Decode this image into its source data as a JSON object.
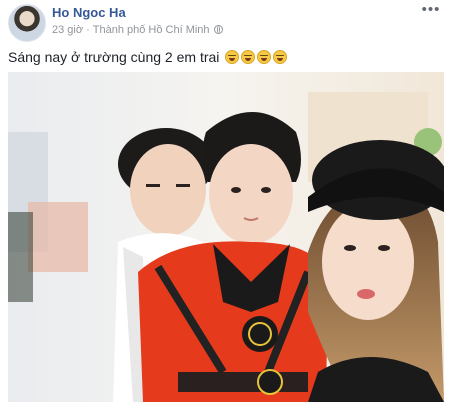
{
  "post": {
    "author": "Ho Ngoc Ha",
    "time": "23 giờ",
    "separator": "·",
    "location": "Thành phố Hồ Chí Minh",
    "more_label": "•••",
    "caption": "Sáng nay ở trường cùng 2 em trai",
    "caption_emoji": [
      "laughing-tears-emoji",
      "laughing-tears-emoji",
      "laughing-tears-emoji",
      "laughing-tears-emoji"
    ]
  },
  "icons": {
    "privacy": "globe-icon",
    "more": "more-dots-icon"
  },
  "colors": {
    "author": "#365899",
    "meta": "#90949c",
    "text": "#1d2129",
    "costume_red": "#e63a1c",
    "hat": "#1a1a1a"
  }
}
